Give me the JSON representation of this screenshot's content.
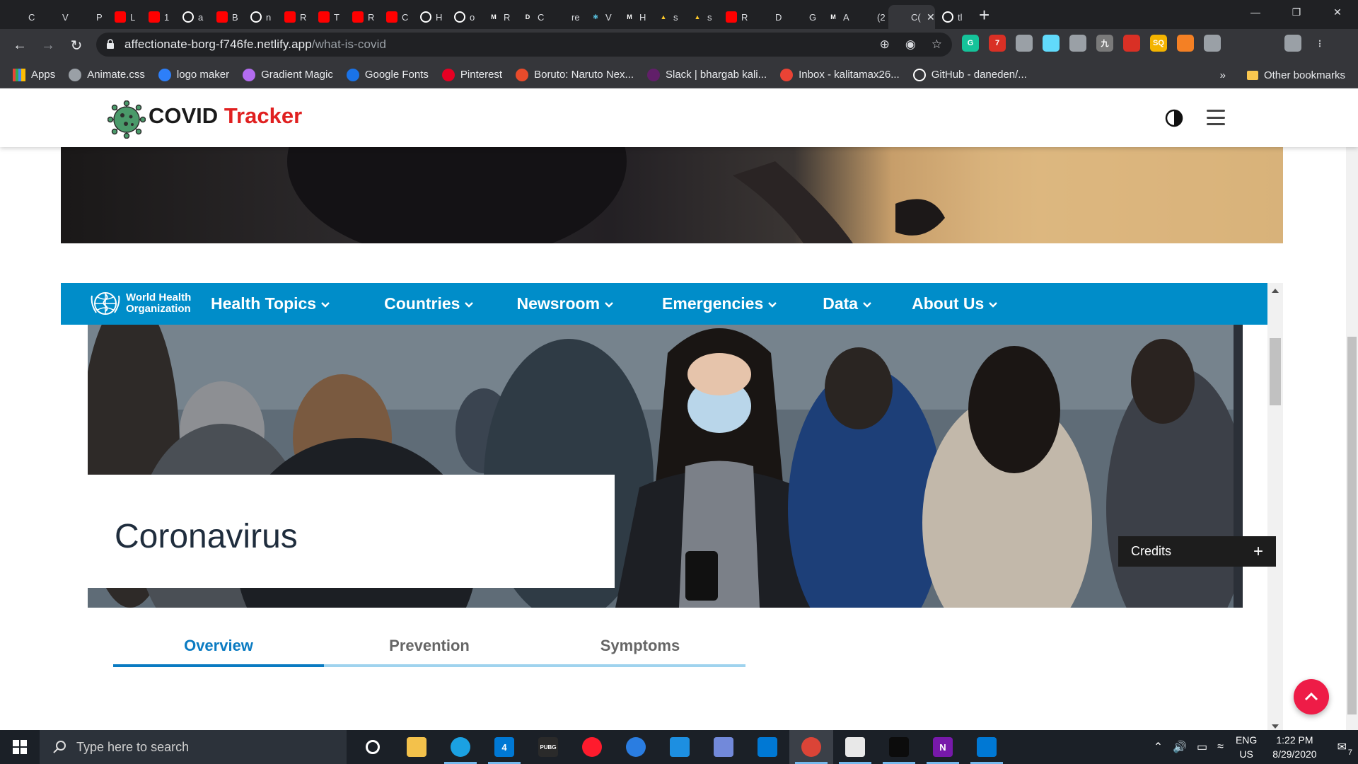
{
  "browser": {
    "tabs": [
      {
        "label": "C",
        "icon": "w-icon",
        "color": "#2b6df5"
      },
      {
        "label": "V",
        "icon": "brain-icon",
        "color": "#2db84c"
      },
      {
        "label": "P",
        "icon": "dribbble-icon",
        "color": "#ea4c89"
      },
      {
        "label": "L",
        "icon": "youtube-icon",
        "color": "#ff0000"
      },
      {
        "label": "1",
        "icon": "youtube-icon",
        "color": "#ff0000"
      },
      {
        "label": "a",
        "icon": "github-icon",
        "color": "#ffffff"
      },
      {
        "label": "B",
        "icon": "youtube-icon",
        "color": "#ff0000"
      },
      {
        "label": "n",
        "icon": "github-icon",
        "color": "#ffffff"
      },
      {
        "label": "R",
        "icon": "youtube-icon",
        "color": "#ff0000"
      },
      {
        "label": "T",
        "icon": "youtube-icon",
        "color": "#ff0000"
      },
      {
        "label": "R",
        "icon": "youtube-icon",
        "color": "#ff0000"
      },
      {
        "label": "C",
        "icon": "youtube-icon",
        "color": "#ff0000"
      },
      {
        "label": "H",
        "icon": "github-icon",
        "color": "#ffffff"
      },
      {
        "label": "o",
        "icon": "github-icon",
        "color": "#ffffff"
      },
      {
        "label": "R",
        "icon": "medium-icon",
        "color": "#ffffff"
      },
      {
        "label": "C",
        "icon": "dev-icon",
        "color": "#ffffff"
      },
      {
        "label": "re",
        "icon": "stackoverflow-icon",
        "color": "#f48024"
      },
      {
        "label": "V",
        "icon": "react-icon",
        "color": "#61dafb"
      },
      {
        "label": "H",
        "icon": "medium-icon",
        "color": "#ffffff"
      },
      {
        "label": "s",
        "icon": "firebase-icon",
        "color": "#ffca28"
      },
      {
        "label": "s",
        "icon": "firebase-icon",
        "color": "#ffca28"
      },
      {
        "label": "R",
        "icon": "youtube-icon",
        "color": "#ff0000"
      },
      {
        "label": "D",
        "icon": "graphql-icon",
        "color": "#7f52ff"
      },
      {
        "label": "G",
        "icon": "apollo-icon",
        "color": "#8c6cf0"
      },
      {
        "label": "A",
        "icon": "medium-icon",
        "color": "#ffffff"
      },
      {
        "label": "(2",
        "icon": "audio-icon",
        "color": "#9aa0a6"
      },
      {
        "label": "C(",
        "icon": "none",
        "color": "#9aa0a6"
      },
      {
        "label": "tl",
        "icon": "github-icon",
        "color": "#ffffff"
      }
    ],
    "new_tab": "+",
    "url_host": "affectionate-borg-f746fe.netlify.app",
    "url_path": "/what-is-covid",
    "bookmarks": [
      {
        "label": "Apps",
        "icon": "apps-grid-icon",
        "color": "#ea4335"
      },
      {
        "label": "Animate.css",
        "icon": "globe-icon",
        "color": "#9aa0a6"
      },
      {
        "label": "logo maker",
        "icon": "c-icon",
        "color": "#2d7ff9"
      },
      {
        "label": "Gradient Magic",
        "icon": "gradient-icon",
        "color": "#b36cf0"
      },
      {
        "label": "Google Fonts",
        "icon": "f-icon",
        "color": "#1a73e8"
      },
      {
        "label": "Pinterest",
        "icon": "pinterest-icon",
        "color": "#e60023"
      },
      {
        "label": "Boruto: Naruto Nex...",
        "icon": "crunchyroll-icon",
        "color": "#e94b2b"
      },
      {
        "label": "Slack | bhargab kali...",
        "icon": "slack-icon",
        "color": "#611f69"
      },
      {
        "label": "Inbox - kalitamax26...",
        "icon": "gmail-icon",
        "color": "#ea4335"
      },
      {
        "label": "GitHub - daneden/...",
        "icon": "github-icon",
        "color": "#ffffff"
      }
    ],
    "bookmarks_overflow": "»",
    "other_bookmarks": "Other bookmarks",
    "extensions": [
      {
        "icon": "grammarly-icon",
        "color": "#15c39a",
        "label": "G"
      },
      {
        "icon": "adblock-icon",
        "color": "#d93025",
        "label": "7"
      },
      {
        "icon": "compass-icon",
        "color": "#9aa0a6",
        "label": ""
      },
      {
        "icon": "react-devtools-icon",
        "color": "#61dafb",
        "label": ""
      },
      {
        "icon": "bulb-icon",
        "color": "#9aa0a6",
        "label": ""
      },
      {
        "icon": "cache-icon",
        "color": "#7a7a7a",
        "label": "九"
      },
      {
        "icon": "bookmark-red-icon",
        "color": "#d93025",
        "label": ""
      },
      {
        "icon": "sq-icon",
        "color": "#f4b400",
        "label": "SQ"
      },
      {
        "icon": "stack-icon",
        "color": "#f48024",
        "label": ""
      },
      {
        "icon": "target-icon",
        "color": "#9aa0a6",
        "label": ""
      },
      {
        "icon": "puzzle-icon",
        "color": "#e8eaed",
        "label": ""
      },
      {
        "icon": "playlist-icon",
        "color": "#e8eaed",
        "label": ""
      },
      {
        "icon": "profile-icon",
        "color": "#9aa0a6",
        "label": ""
      },
      {
        "icon": "kebab-icon",
        "color": "#e8eaed",
        "label": "⋮"
      }
    ]
  },
  "app": {
    "brand_main": "COVID",
    "brand_accent": "Tracker",
    "accent_color": "#e02020"
  },
  "who": {
    "org_name_line1": "World Health",
    "org_name_line2": "Organization",
    "menu": [
      "Health Topics",
      "Countries",
      "Newsroom",
      "Emergencies",
      "Data",
      "About Us"
    ],
    "nav_color": "#008dc9",
    "page_title": "Coronavirus",
    "credits_label": "Credits",
    "credits_icon": "+",
    "tabs": [
      "Overview",
      "Prevention",
      "Symptoms"
    ],
    "active_tab": "Overview"
  },
  "taskbar": {
    "search_placeholder": "Type here to search",
    "apps": [
      {
        "name": "cortana-icon",
        "label": "",
        "color": "#ffffff"
      },
      {
        "name": "file-explorer-icon",
        "label": "",
        "color": "#f3c14b"
      },
      {
        "name": "edge-icon",
        "label": "",
        "color": "#1ba1e2"
      },
      {
        "name": "mail-icon",
        "label": "4",
        "color": "#0078d4"
      },
      {
        "name": "pubg-icon",
        "label": "PUBG",
        "color": "#2a2a2a"
      },
      {
        "name": "opera-icon",
        "label": "",
        "color": "#ff1b2d"
      },
      {
        "name": "firefox-icon",
        "label": "",
        "color": "#2a7de1"
      },
      {
        "name": "video-icon",
        "label": "",
        "color": "#1d8fe1"
      },
      {
        "name": "discord-icon",
        "label": "",
        "color": "#7289da"
      },
      {
        "name": "store-icon",
        "label": "",
        "color": "#0078d4"
      },
      {
        "name": "chrome-icon",
        "label": "",
        "color": "#db4437"
      },
      {
        "name": "paint-icon",
        "label": "",
        "color": "#e8e8e8"
      },
      {
        "name": "terminal-icon",
        "label": "",
        "color": "#0c0c0c"
      },
      {
        "name": "onenote-icon",
        "label": "N",
        "color": "#7719aa"
      },
      {
        "name": "vscode-icon",
        "label": "",
        "color": "#0078d4"
      }
    ],
    "lang_line1": "ENG",
    "lang_line2": "US",
    "time": "1:22 PM",
    "date": "8/29/2020",
    "notification_count": "7"
  }
}
